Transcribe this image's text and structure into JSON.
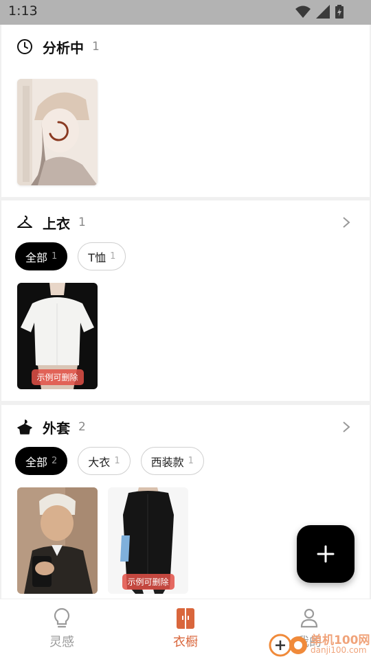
{
  "status_bar": {
    "time": "1:13"
  },
  "sections": {
    "analyzing": {
      "title": "分析中",
      "count": "1"
    },
    "tops": {
      "title": "上衣",
      "count": "1",
      "chips": [
        {
          "label": "全部",
          "count": "1"
        },
        {
          "label": "T恤",
          "count": "1"
        }
      ],
      "items": [
        {
          "tag": "示例可删除"
        }
      ]
    },
    "outerwear": {
      "title": "外套",
      "count": "2",
      "chips": [
        {
          "label": "全部",
          "count": "2"
        },
        {
          "label": "大衣",
          "count": "1"
        },
        {
          "label": "西装款",
          "count": "1"
        }
      ],
      "items": [
        {
          "tag": ""
        },
        {
          "tag": "示例可删除"
        }
      ]
    }
  },
  "tabbar": {
    "items": [
      {
        "label": "灵感",
        "icon": "lightbulb-icon"
      },
      {
        "label": "衣橱",
        "icon": "wardrobe-icon"
      },
      {
        "label": "我的",
        "icon": "person-icon"
      }
    ],
    "active_color": "#d9663c"
  },
  "watermark": {
    "line1": "单机100网",
    "line2": "danji100.com"
  },
  "icons": [
    "clock-icon",
    "hanger-icon",
    "coat-icon",
    "chevron-right-icon",
    "plus-icon",
    "wifi-icon",
    "signal-icon",
    "battery-icon"
  ]
}
